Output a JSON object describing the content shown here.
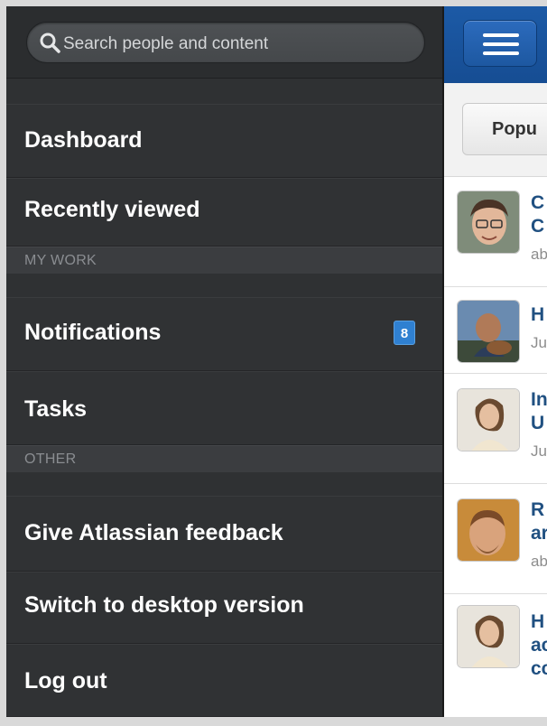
{
  "search": {
    "placeholder": "Search people and content"
  },
  "sidebar": {
    "items": [
      {
        "label": "Dashboard"
      },
      {
        "label": "Recently viewed"
      }
    ],
    "sections": [
      {
        "header": "MY WORK",
        "items": [
          {
            "label": "Notifications",
            "badge": "8"
          },
          {
            "label": "Tasks"
          }
        ]
      },
      {
        "header": "OTHER",
        "items": [
          {
            "label": "Give Atlassian feedback"
          },
          {
            "label": "Switch to desktop version"
          },
          {
            "label": "Log out"
          }
        ]
      }
    ]
  },
  "content": {
    "tab_label": "Popu",
    "feed": [
      {
        "line1": "C",
        "line2": "C",
        "meta": "ab"
      },
      {
        "line1": "H",
        "meta": "Ju"
      },
      {
        "line1": "In",
        "line2": "U",
        "meta": "Ju"
      },
      {
        "line1": "R",
        "line2": "ar",
        "meta": "ab"
      },
      {
        "line1": "H",
        "line2": "ac",
        "line3": "cc"
      }
    ]
  },
  "colors": {
    "sidebar_bg": "#2f3133",
    "section_bg": "#3b3d40",
    "badge_bg": "#2f80d1",
    "header_blue": "#1c5aa6",
    "link_blue": "#205081"
  }
}
